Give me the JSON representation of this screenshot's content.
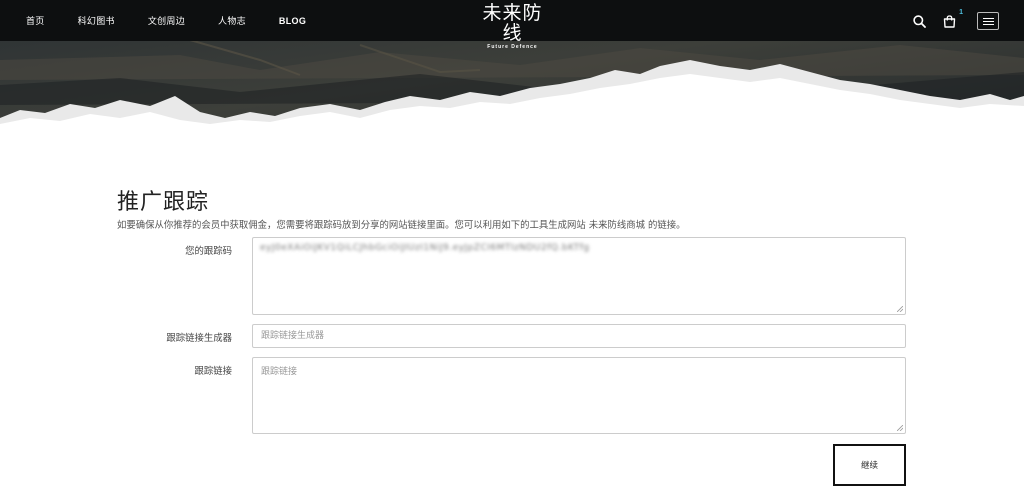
{
  "navbar": {
    "links": [
      {
        "label": "首页"
      },
      {
        "label": "科幻图书"
      },
      {
        "label": "文创周边"
      },
      {
        "label": "人物志"
      },
      {
        "label": "BLOG"
      }
    ],
    "logo": {
      "main": "未来防线",
      "sub": "Future Defence"
    },
    "search_icon": "search-icon",
    "cart_icon": "shopping-bag-icon",
    "cart_count": "1",
    "menu_icon": "hamburger-menu-icon"
  },
  "page": {
    "title": "推广跟踪",
    "description": "如要确保从你推荐的会员中获取佣金，您需要将跟踪码放到分享的网站链接里面。您可以利用如下的工具生成网站 未来防线商城 的链接。"
  },
  "form": {
    "tracking_code": {
      "label": "您的跟踪码",
      "value": "eyJ0eXAiOiJKV1QiLCJhbGciOiJIUzI1NiJ9.eyJpZCI6MTIzNDU2fQ.bKTfg"
    },
    "link_generator": {
      "label": "跟踪链接生成器",
      "placeholder": "跟踪链接生成器",
      "value": ""
    },
    "tracking_link": {
      "label": "跟踪链接",
      "placeholder": "跟踪链接",
      "value": ""
    },
    "continue_label": "继续"
  },
  "colors": {
    "navbar_bg": "#0d0f10",
    "cart_badge": "#4ec1e0",
    "button_border": "#111111"
  }
}
